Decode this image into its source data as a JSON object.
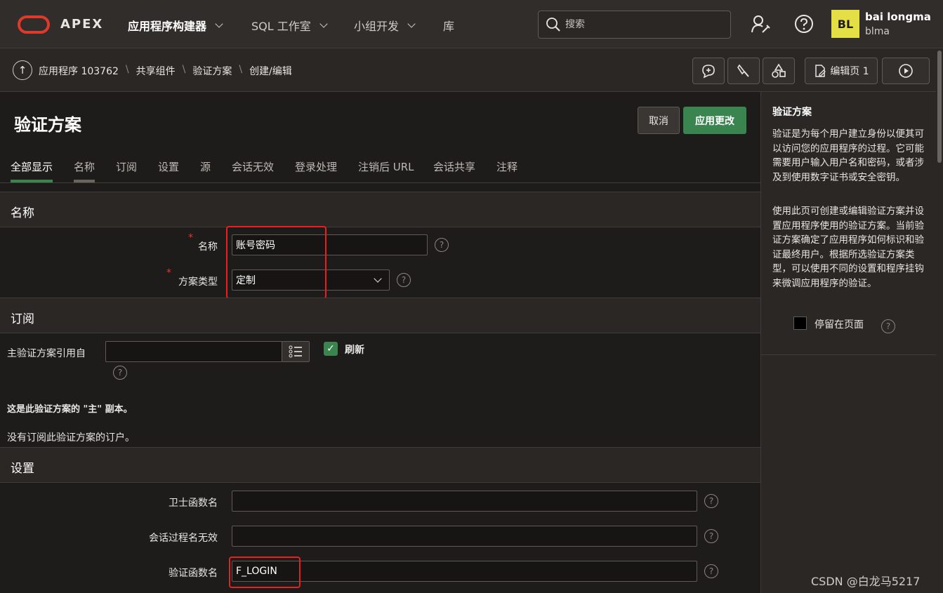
{
  "topnav": {
    "brand": "APEX",
    "items": [
      {
        "label": "应用程序构建器",
        "dropdown": true,
        "active": true
      },
      {
        "label": "SQL 工作室",
        "dropdown": true
      },
      {
        "label": "小组开发",
        "dropdown": true
      },
      {
        "label": "库",
        "dropdown": false
      }
    ],
    "search_placeholder": "搜索",
    "user": {
      "initials": "BL",
      "name": "bai longma",
      "id": "blma"
    }
  },
  "breadcrumb": [
    "应用程序 103762",
    "共享组件",
    "验证方案",
    "创建/编辑"
  ],
  "toolbar": {
    "edit_page_label": "编辑页 1"
  },
  "page": {
    "title": "验证方案",
    "cancel_label": "取消",
    "apply_label": "应用更改"
  },
  "tabs": [
    "全部显示",
    "名称",
    "订阅",
    "设置",
    "源",
    "会话无效",
    "登录处理",
    "注销后 URL",
    "会话共享",
    "注释"
  ],
  "sections": {
    "name": {
      "heading": "名称",
      "name_label": "名称",
      "name_value": "账号密码",
      "type_label": "方案类型",
      "type_value": "定制"
    },
    "subscription": {
      "heading": "订阅",
      "ref_label": "主验证方案引用自",
      "refresh_label": "刷新",
      "master_note": "这是此验证方案的 \"主\" 副本。",
      "no_subscribers": "没有订阅此验证方案的订户。"
    },
    "settings": {
      "heading": "设置",
      "sentry_label": "卫士函数名",
      "session_invalid_label": "会话过程名无效",
      "auth_fn_label": "验证函数名",
      "auth_fn_value": "F_LOGIN"
    }
  },
  "help_panel": {
    "title": "验证方案",
    "p1": "验证是为每个用户建立身份以便其可以访问您的应用程序的过程。它可能需要用户输入用户名和密码，或者涉及到使用数字证书或安全密钥。",
    "p2": "使用此页可创建或编辑验证方案并设置应用程序使用的验证方案。当前验证方案确定了应用程序如何标识和验证最终用户。根据所选验证方案类型，可以使用不同的设置和程序挂钩来微调应用程序的验证。",
    "stay_label": "停留在页面"
  },
  "watermark": "CSDN @白龙马5217",
  "colors": {
    "accent": "#3a8450",
    "brand_red": "#e0382b",
    "highlight": "#e82020",
    "avatar": "#e4df44"
  }
}
